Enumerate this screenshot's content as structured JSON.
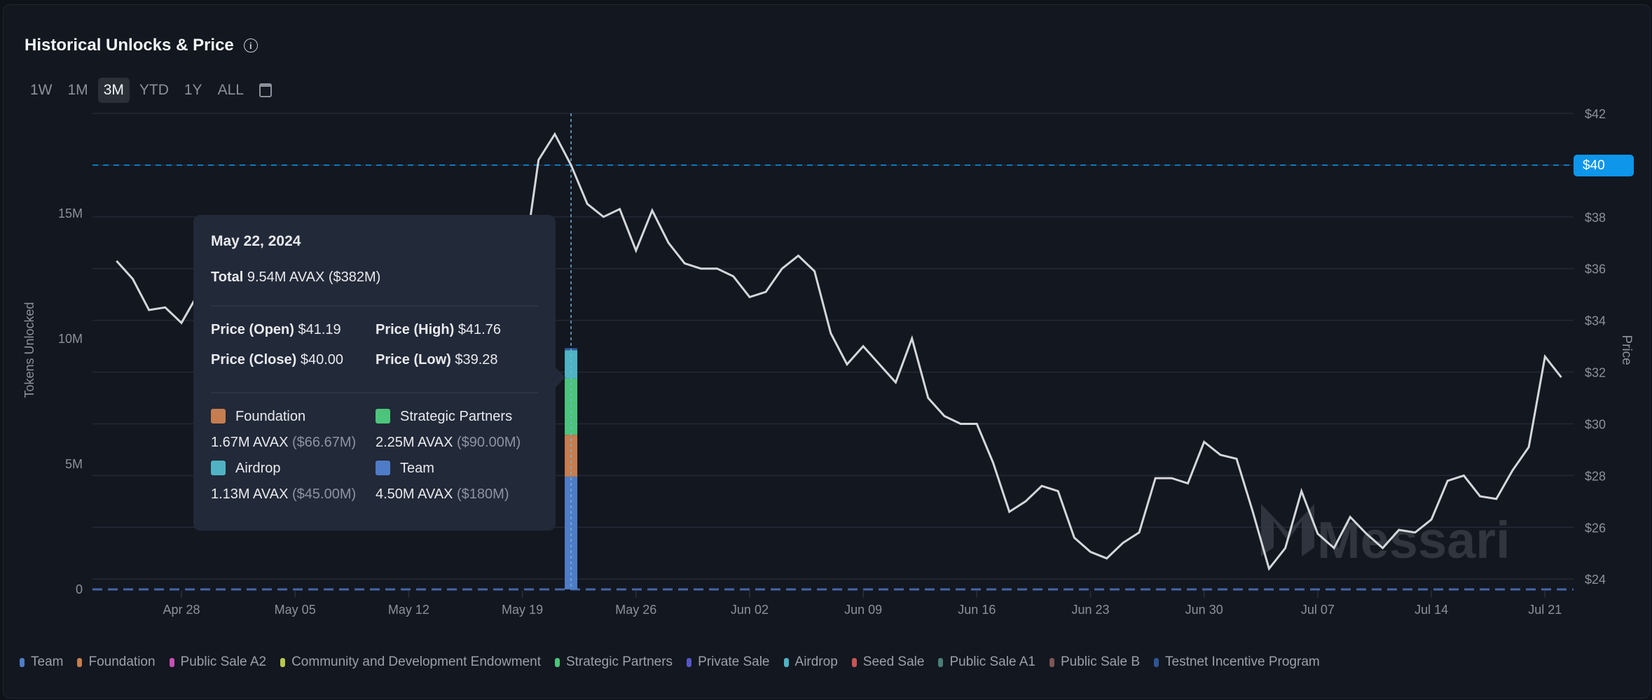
{
  "header": {
    "title": "Historical Unlocks & Price",
    "info_icon": "info-icon"
  },
  "ranges": [
    {
      "label": "1W"
    },
    {
      "label": "1M"
    },
    {
      "label": "3M",
      "active": true
    },
    {
      "label": "YTD"
    },
    {
      "label": "1Y"
    },
    {
      "label": "ALL"
    }
  ],
  "calendar_icon": "calendar-icon",
  "tooltip": {
    "date": "May 22, 2024",
    "total_label": "Total",
    "total_value": "9.54M AVAX ($382M)",
    "open_label": "Price (Open)",
    "open": "$41.19",
    "high_label": "Price (High)",
    "high": "$41.76",
    "close_label": "Price (Close)",
    "close": "$40.00",
    "low_label": "Price (Low)",
    "low": "$39.28",
    "items": [
      {
        "name": "Foundation",
        "amount": "1.67M AVAX",
        "usd": "($66.67M)",
        "color": "#c67d4f"
      },
      {
        "name": "Strategic Partners",
        "amount": "2.25M AVAX",
        "usd": "($90.00M)",
        "color": "#4cc47b"
      },
      {
        "name": "Airdrop",
        "amount": "1.13M AVAX",
        "usd": "($45.00M)",
        "color": "#4fb3c4"
      },
      {
        "name": "Team",
        "amount": "4.50M AVAX",
        "usd": "($180M)",
        "color": "#4f7cc6"
      }
    ]
  },
  "crosshair_price_label": "$40",
  "watermark": "Messari",
  "chart_data": {
    "type": "bar+line",
    "title": "Historical Unlocks & Price",
    "ylabel_left": "Tokens Unlocked",
    "ylabel_right": "Price",
    "ylim_left": [
      0,
      19000000
    ],
    "ylim_right": [
      23.6,
      42
    ],
    "yticks_left": [
      "0",
      "5M",
      "10M",
      "15M"
    ],
    "yticks_left_values": [
      0,
      5000000,
      10000000,
      15000000
    ],
    "yticks_right": [
      "$24",
      "$26",
      "$28",
      "$30",
      "$32",
      "$34",
      "$36",
      "$38",
      "$40",
      "$42"
    ],
    "yticks_right_values": [
      24,
      26,
      28,
      30,
      32,
      34,
      36,
      38,
      40,
      42
    ],
    "xticks": [
      "Apr 28",
      "May 05",
      "May 12",
      "May 19",
      "May 26",
      "Jun 02",
      "Jun 09",
      "Jun 16",
      "Jun 23",
      "Jun 30",
      "Jul 07",
      "Jul 14",
      "Jul 21"
    ],
    "xticks_dates": [
      "2024-04-28",
      "2024-05-05",
      "2024-05-12",
      "2024-05-19",
      "2024-05-26",
      "2024-06-02",
      "2024-06-09",
      "2024-06-16",
      "2024-06-23",
      "2024-06-30",
      "2024-07-07",
      "2024-07-14",
      "2024-07-21"
    ],
    "grid": true,
    "legend_position": "bottom",
    "price_series": {
      "start_date": "2024-04-24",
      "values": [
        36.3,
        35.6,
        34.4,
        34.5,
        33.9,
        35.0,
        33.5,
        31.5,
        32.0,
        33.5,
        35.0,
        36.5,
        36.0,
        34.5,
        33.8,
        34.2,
        33.0,
        33.2,
        33.5,
        33.8,
        32.8,
        35.0,
        35.3,
        36.5,
        36.3,
        35.8,
        40.2,
        41.2,
        40.0,
        38.5,
        38.0,
        38.3,
        36.7,
        38.25,
        37.0,
        36.2,
        36.0,
        36.0,
        35.7,
        34.9,
        35.1,
        36.0,
        36.5,
        35.9,
        33.5,
        32.3,
        33.0,
        32.3,
        31.6,
        33.3,
        31.0,
        30.3,
        30.0,
        30.0,
        28.5,
        26.6,
        27.0,
        27.6,
        27.4,
        25.6,
        25.05,
        24.8,
        25.4,
        25.8,
        27.9,
        27.9,
        27.7,
        29.3,
        28.8,
        28.65,
        26.6,
        24.4,
        25.2,
        27.4,
        25.75,
        25.2,
        26.4,
        25.75,
        25.2,
        25.9,
        25.8,
        26.3,
        27.8,
        28.0,
        27.2,
        27.1,
        28.2,
        29.1,
        32.6,
        31.8
      ]
    },
    "unlock_bars": [
      {
        "date": "2024-05-22",
        "segments": [
          {
            "name": "Team",
            "value": 4500000
          },
          {
            "name": "Foundation",
            "value": 1670000
          },
          {
            "name": "Strategic Partners",
            "value": 2250000
          },
          {
            "name": "Airdrop",
            "value": 1130000
          }
        ]
      }
    ],
    "highlight_date": "2024-05-22",
    "crosshair_price": 40,
    "series_colors": {
      "price": "#d4d6da",
      "crosshair": "#0d96ea"
    },
    "legend": [
      {
        "name": "Team",
        "color": "#4f7cc6"
      },
      {
        "name": "Foundation",
        "color": "#c67d4f"
      },
      {
        "name": "Public Sale A2",
        "color": "#c94fb3"
      },
      {
        "name": "Community and Development Endowment",
        "color": "#b5c84a"
      },
      {
        "name": "Strategic Partners",
        "color": "#4cc47b"
      },
      {
        "name": "Private Sale",
        "color": "#5555c8"
      },
      {
        "name": "Airdrop",
        "color": "#4fb3c4"
      },
      {
        "name": "Seed Sale",
        "color": "#c95454"
      },
      {
        "name": "Public Sale A1",
        "color": "#4a7d78"
      },
      {
        "name": "Public Sale B",
        "color": "#7d5656"
      },
      {
        "name": "Testnet Incentive Program",
        "color": "#2f5596"
      }
    ]
  }
}
